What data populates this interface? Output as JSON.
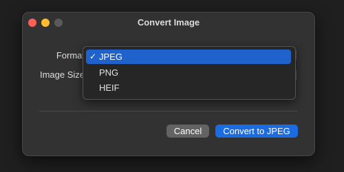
{
  "dialog": {
    "title": "Convert Image"
  },
  "form": {
    "format_label": "Format",
    "size_label": "Image Size"
  },
  "format_menu": {
    "checkmark": "✓",
    "options": [
      {
        "label": "JPEG",
        "selected": true
      },
      {
        "label": "PNG",
        "selected": false
      },
      {
        "label": "HEIF",
        "selected": false
      }
    ]
  },
  "buttons": {
    "cancel": "Cancel",
    "convert": "Convert to JPEG"
  },
  "colors": {
    "accent": "#1a6ce0",
    "close": "#ff5f57",
    "minimize": "#febc2e"
  }
}
